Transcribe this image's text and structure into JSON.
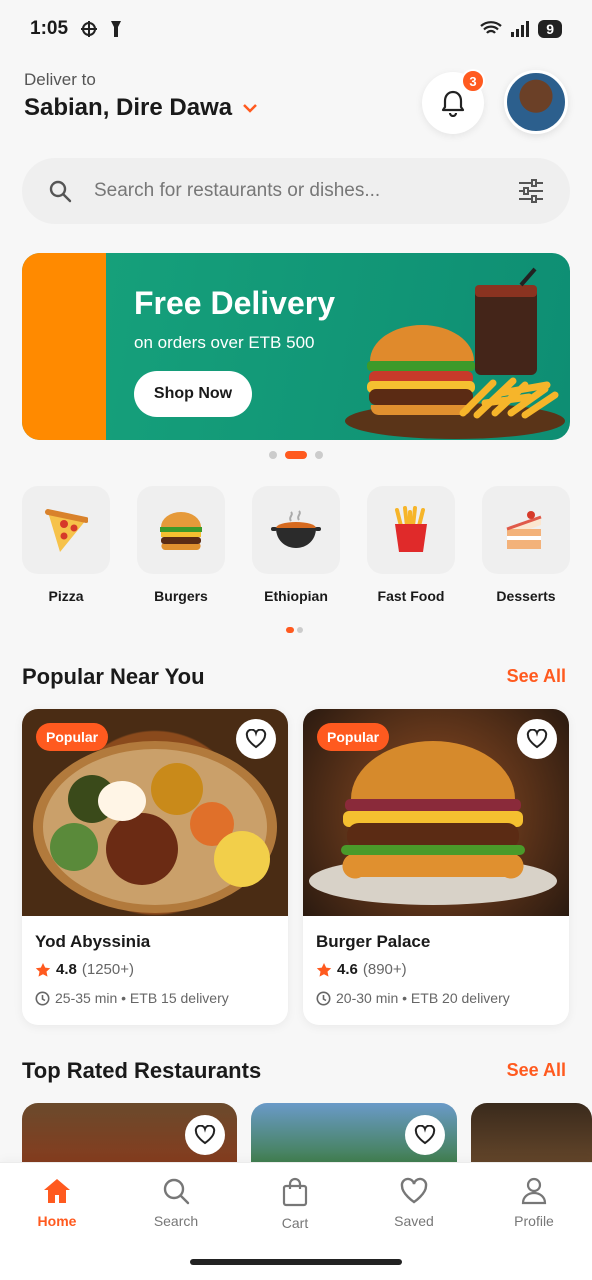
{
  "status": {
    "time": "1:05",
    "battery": "9"
  },
  "header": {
    "deliver_label": "Deliver to",
    "location": "Sabian, Dire Dawa",
    "notif_count": "3"
  },
  "search": {
    "placeholder": "Search for restaurants or dishes..."
  },
  "banner": {
    "title": "Free Delivery",
    "subtitle": "on orders over ETB 500",
    "button": "Shop Now"
  },
  "categories": [
    {
      "label": "Pizza",
      "icon": "pizza-icon"
    },
    {
      "label": "Burgers",
      "icon": "burger-icon"
    },
    {
      "label": "Ethiopian",
      "icon": "ethiopian-pot-icon"
    },
    {
      "label": "Fast Food",
      "icon": "fries-icon"
    },
    {
      "label": "Desserts",
      "icon": "cake-icon"
    }
  ],
  "popular": {
    "title": "Popular Near You",
    "see_all": "See All",
    "items": [
      {
        "tag": "Popular",
        "name": "Yod Abyssinia",
        "rating": "4.8",
        "count": "(1250+)",
        "meta": "25-35 min • ETB 15 delivery"
      },
      {
        "tag": "Popular",
        "name": "Burger Palace",
        "rating": "4.6",
        "count": "(890+)",
        "meta": "20-30 min • ETB 20 delivery"
      }
    ]
  },
  "top_rated": {
    "title": "Top Rated Restaurants",
    "see_all": "See All"
  },
  "nav": [
    {
      "label": "Home",
      "icon": "home-icon"
    },
    {
      "label": "Search",
      "icon": "search-icon"
    },
    {
      "label": "Cart",
      "icon": "shopping-bag-icon"
    },
    {
      "label": "Saved",
      "icon": "heart-icon"
    },
    {
      "label": "Profile",
      "icon": "person-icon"
    }
  ],
  "colors": {
    "accent": "#ff5a1f",
    "banner_green": "#17a37c",
    "banner_orange": "#ff8a00"
  }
}
